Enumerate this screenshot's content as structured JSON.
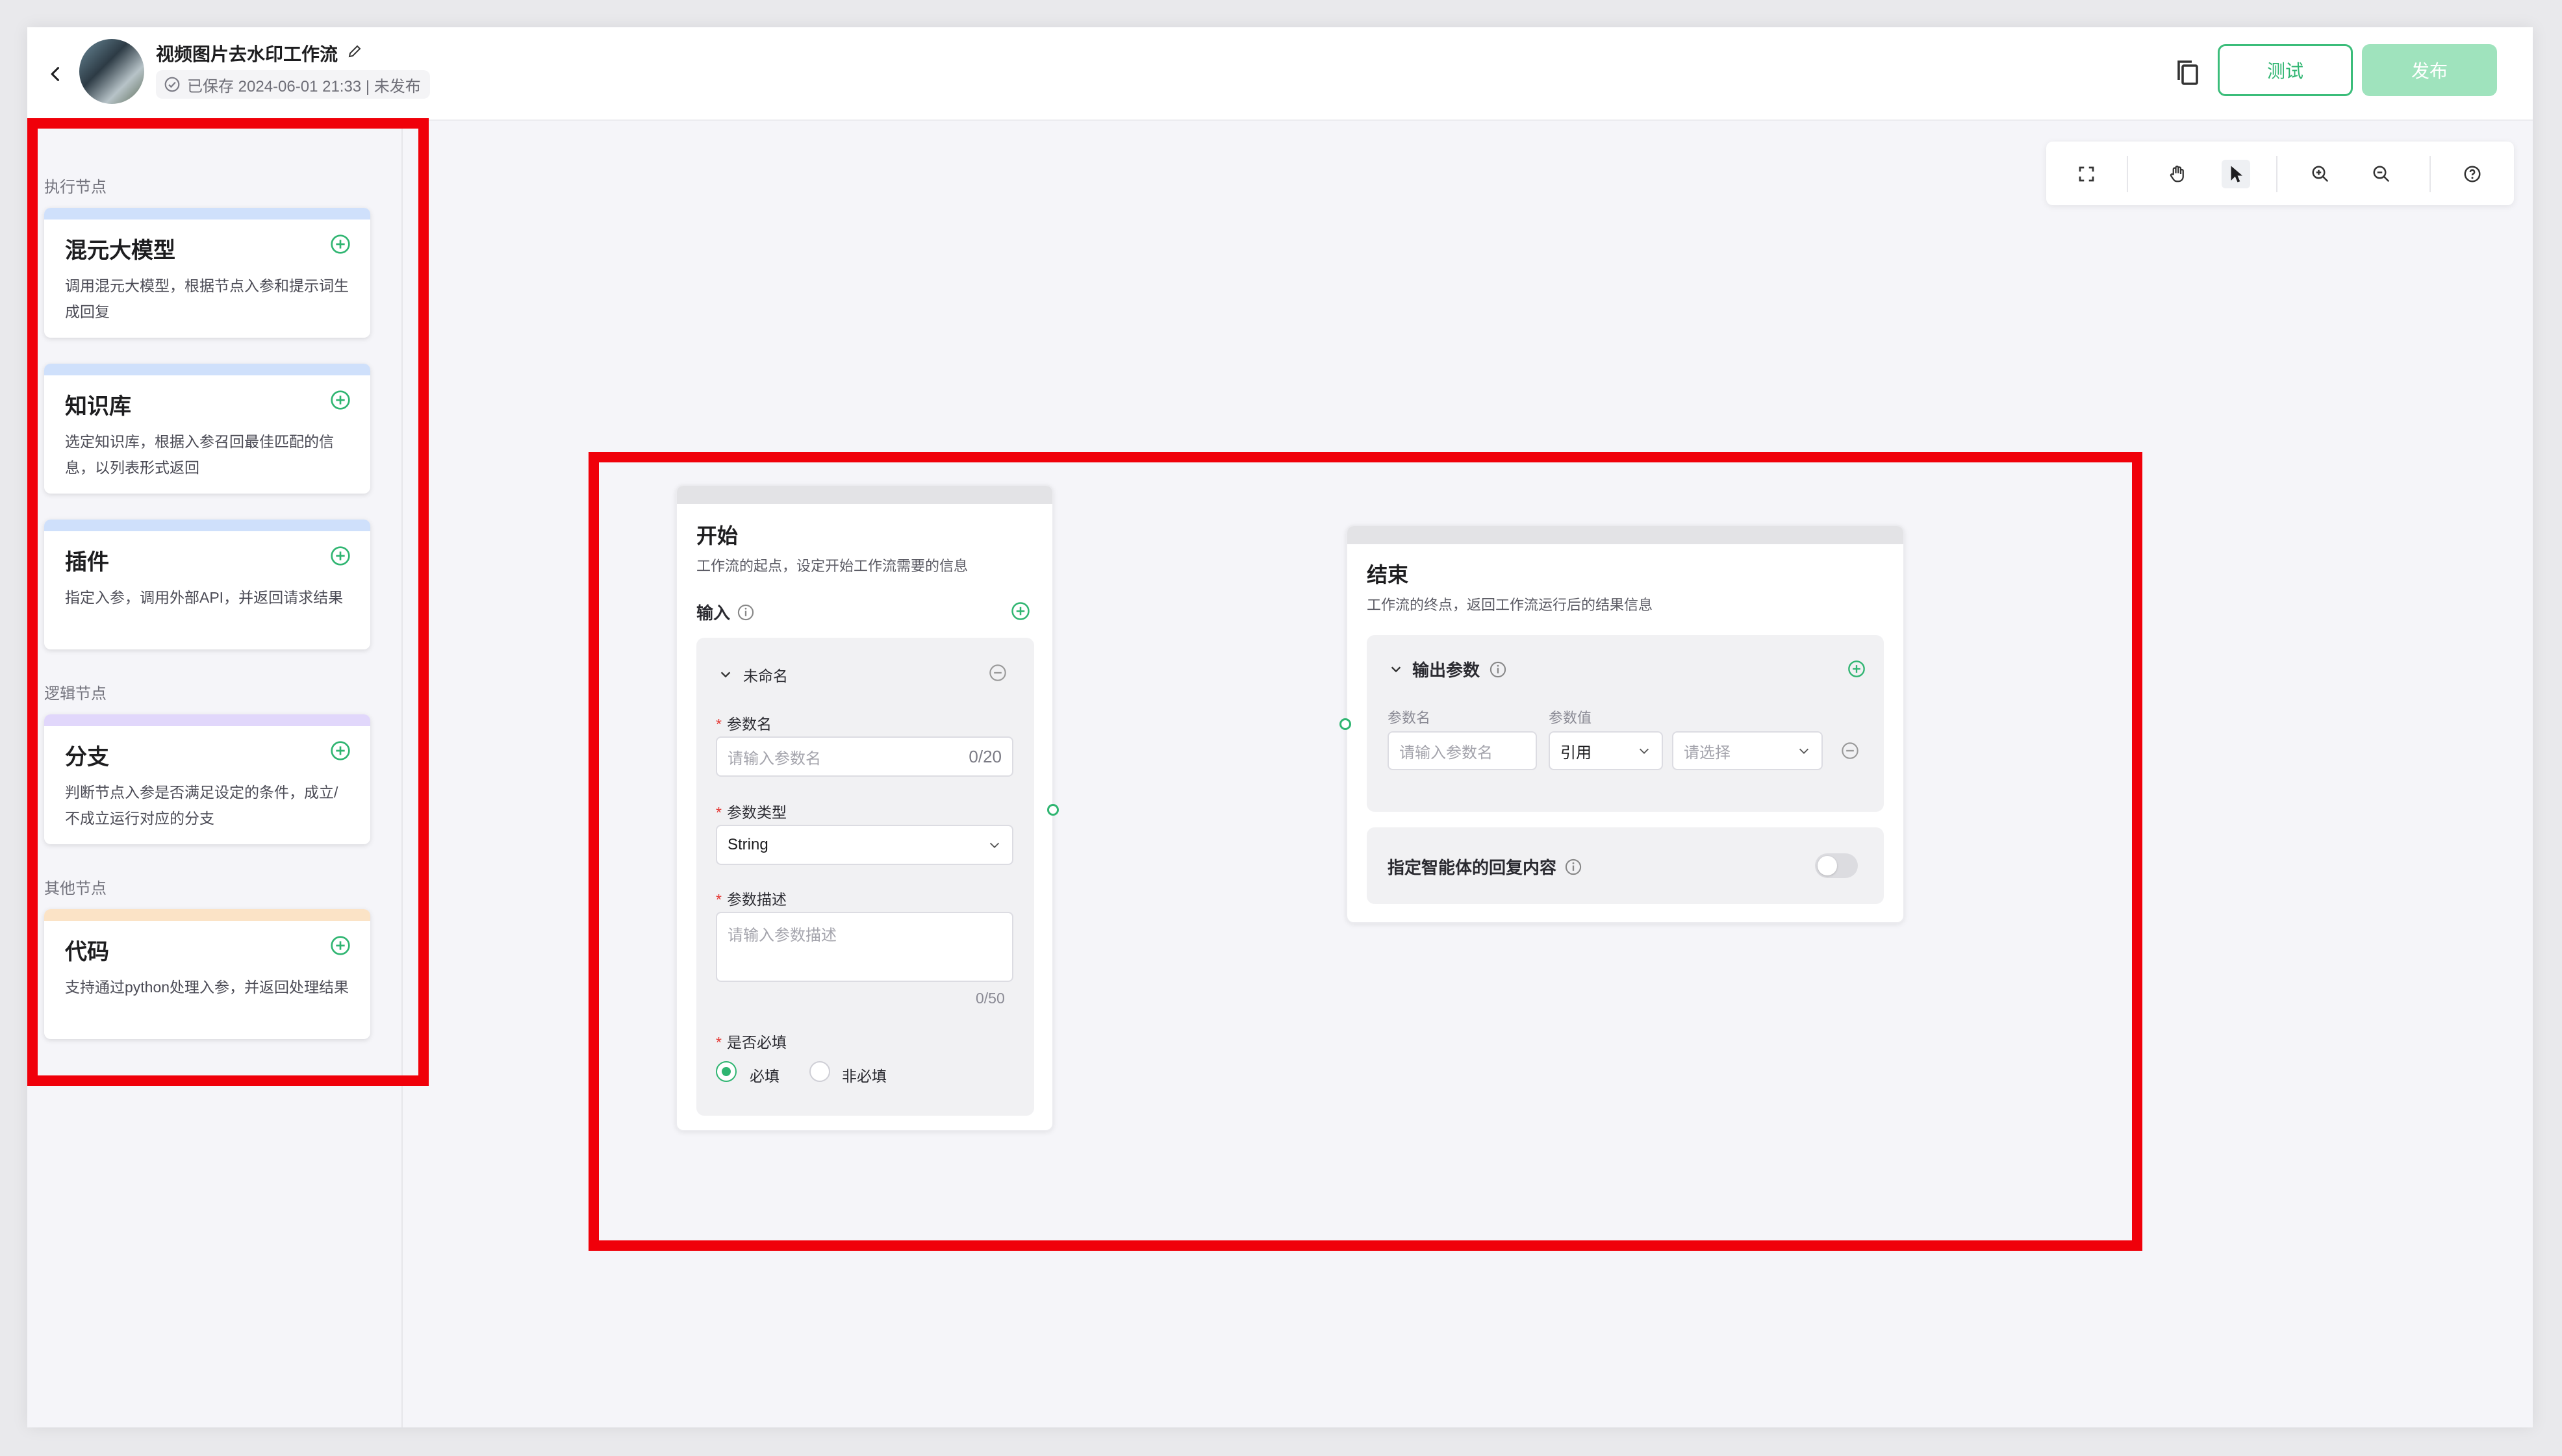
{
  "header": {
    "title": "视频图片去水印工作流",
    "save_status": "已保存 2024-06-01 21:33 | 未发布",
    "test_label": "测试",
    "publish_label": "发布"
  },
  "sidebar": {
    "sections": {
      "execute": "执行节点",
      "logic": "逻辑节点",
      "other": "其他节点"
    },
    "nodes": [
      {
        "name": "混元大模型",
        "desc": "调用混元大模型，根据节点入参和提示词生成回复",
        "color": "#cfe0fb"
      },
      {
        "name": "知识库",
        "desc": "选定知识库，根据入参召回最佳匹配的信息，以列表形式返回",
        "color": "#cfe0fb"
      },
      {
        "name": "插件",
        "desc": "指定入参，调用外部API，并返回请求结果",
        "color": "#cfe0fb"
      },
      {
        "name": "分支",
        "desc": "判断节点入参是否满足设定的条件，成立/不成立运行对应的分支",
        "color": "#e1d7fb"
      },
      {
        "name": "代码",
        "desc": "支持通过python处理入参，并返回处理结果",
        "color": "#fbe3c6"
      }
    ]
  },
  "start_node": {
    "title": "开始",
    "desc": "工作流的起点，设定开始工作流需要的信息",
    "input_label": "输入",
    "param_group": "未命名",
    "param_name_label": "参数名",
    "param_name_placeholder": "请输入参数名",
    "param_name_count": "0/20",
    "param_type_label": "参数类型",
    "param_type_value": "String",
    "param_desc_label": "参数描述",
    "param_desc_placeholder": "请输入参数描述",
    "param_desc_count": "0/50",
    "required_label": "是否必填",
    "required_yes": "必填",
    "required_no": "非必填"
  },
  "end_node": {
    "title": "结束",
    "desc": "工作流的终点，返回工作流运行后的结果信息",
    "output_label": "输出参数",
    "col_name": "参数名",
    "col_value": "参数值",
    "name_placeholder": "请输入参数名",
    "ref_value": "引用",
    "select_placeholder": "请选择",
    "reply_label": "指定智能体的回复内容"
  },
  "colors": {
    "accent": "#2fb571",
    "highlight": "#f0000a"
  }
}
